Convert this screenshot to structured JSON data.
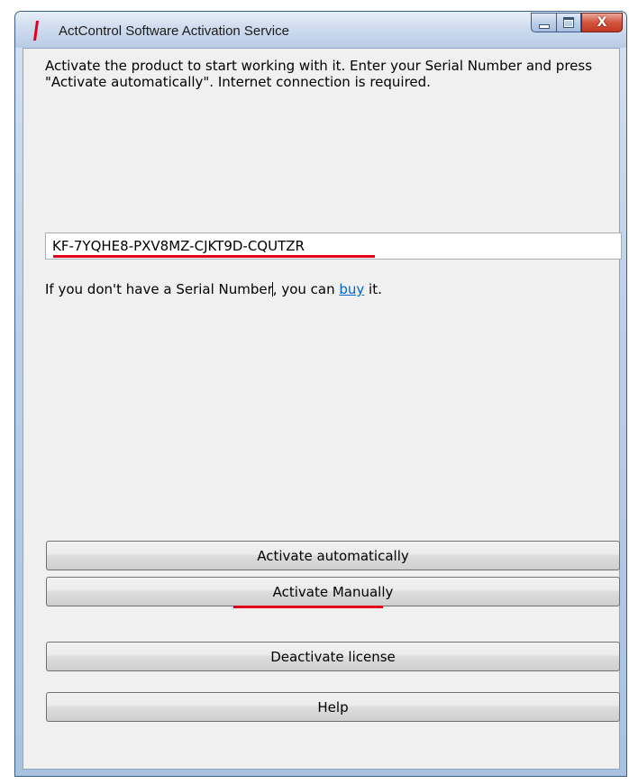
{
  "window": {
    "title": "ActControl Software Activation Service",
    "caption_buttons": {
      "minimize_icon": "minimize-icon",
      "maximize_icon": "maximize-icon",
      "close_glyph": "X"
    }
  },
  "content": {
    "description": "Activate the product to start working with it. Enter your Serial Number and press \"Activate automatically\". Internet connection is required.",
    "serial_value": "KF-7YQHE8-PXV8MZ-CJKT9D-CQUTZR",
    "buy_prefix": "If you don't have a Serial Number",
    "buy_middle": ", you can ",
    "buy_link": "buy",
    "buy_suffix": " it."
  },
  "buttons": {
    "activate_automatically": "Activate automatically",
    "activate_manually": "Activate Manually",
    "deactivate_license": "Deactivate license",
    "help": "Help"
  },
  "colors": {
    "annotation_red": "#e3001b",
    "link": "#0066cc",
    "app_icon": "#e3001b"
  }
}
